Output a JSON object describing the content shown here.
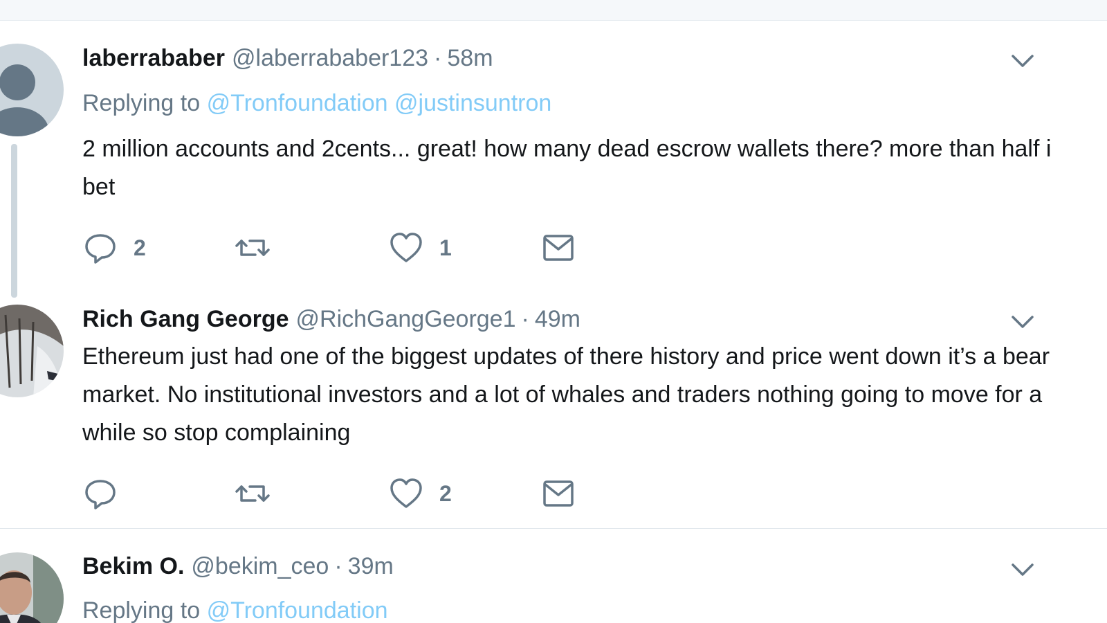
{
  "tweets": [
    {
      "name": "laberrababer",
      "handle": "@laberrababer123",
      "separator": "·",
      "time": "58m",
      "replying_label": "Replying to",
      "mentions": [
        "@Tronfoundation",
        "@justinsuntron"
      ],
      "text": "2 million accounts and 2cents... great! how many dead escrow wallets there? more than half i bet",
      "reply_count": "2",
      "retweet_count": "",
      "like_count": "1",
      "avatar": "default-avatar-icon"
    },
    {
      "name": "Rich Gang George",
      "handle": "@RichGangGeorge1",
      "separator": "·",
      "time": "49m",
      "text": "Ethereum just had one of the biggest updates of there history and price went down it’s a bear market. No institutional investors and a lot of whales and traders nothing going to move for a while so stop complaining",
      "reply_count": "",
      "retweet_count": "",
      "like_count": "2",
      "avatar": "photo-avatar"
    },
    {
      "name": "Bekim O.",
      "handle": "@bekim_ceo",
      "separator": "·",
      "time": "39m",
      "replying_label": "Replying to",
      "mentions": [
        "@Tronfoundation"
      ],
      "avatar": "photo-avatar"
    }
  ],
  "icons": {
    "reply": "reply-icon",
    "retweet": "retweet-icon",
    "like": "heart-icon",
    "message": "envelope-icon",
    "more": "chevron-down-icon"
  },
  "colors": {
    "text": "#14171a",
    "muted": "#657786",
    "link": "#1da1f2",
    "thread_line": "#ccd6dd",
    "divider": "#e1e8ed",
    "top_band": "#f5f8fa"
  }
}
